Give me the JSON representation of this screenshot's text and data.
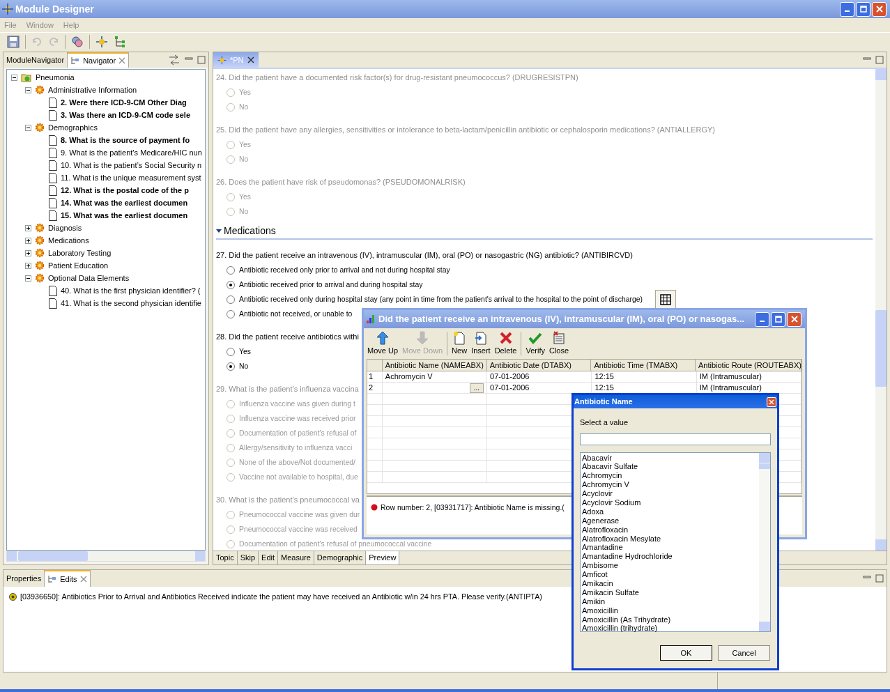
{
  "window": {
    "title": "Module Designer"
  },
  "menu": [
    "File",
    "Window",
    "Help"
  ],
  "left_panel": {
    "tabs": [
      {
        "label": "ModuleNavigator",
        "selected": false
      },
      {
        "label": "Navigator",
        "selected": true
      }
    ],
    "tree": {
      "label": "Pneumonia",
      "kind": "root",
      "expanded": true,
      "children": [
        {
          "label": "Administrative Information",
          "kind": "category",
          "expanded": true,
          "children": [
            {
              "label": "2. Were there ICD-9-CM Other Diag",
              "kind": "question",
              "bold": true
            },
            {
              "label": "3. Was there an ICD-9-CM code sele",
              "kind": "question",
              "bold": true
            }
          ]
        },
        {
          "label": "Demographics",
          "kind": "category",
          "expanded": true,
          "children": [
            {
              "label": "8. What is the source of payment fo",
              "kind": "question",
              "bold": true
            },
            {
              "label": "9. What is the patient’s Medicare/HIC nun",
              "kind": "question",
              "bold": false
            },
            {
              "label": "10. What is the patient’s Social Security n",
              "kind": "question",
              "bold": false
            },
            {
              "label": "11. What is the unique measurement syst",
              "kind": "question",
              "bold": false
            },
            {
              "label": "12. What is the postal code of the p",
              "kind": "question",
              "bold": true
            },
            {
              "label": "14. What was the earliest documen",
              "kind": "question",
              "bold": true
            },
            {
              "label": "15. What was the earliest documen",
              "kind": "question",
              "bold": true
            }
          ]
        },
        {
          "label": "Diagnosis",
          "kind": "category",
          "expanded": false
        },
        {
          "label": "Medications",
          "kind": "category",
          "expanded": false
        },
        {
          "label": "Laboratory Testing",
          "kind": "category",
          "expanded": false
        },
        {
          "label": "Patient Education",
          "kind": "category",
          "expanded": false
        },
        {
          "label": "Optional Data Elements",
          "kind": "category",
          "expanded": true,
          "children": [
            {
              "label": "40. What is the first physician identifier? (",
              "kind": "question",
              "bold": false
            },
            {
              "label": "41. What is the second physician identifie",
              "kind": "question",
              "bold": false
            }
          ]
        }
      ]
    }
  },
  "editor": {
    "tab": "*PN",
    "items": [
      {
        "kind": "question",
        "text": "24. Did the patient have a documented risk factor(s) for drug-resistant pneumococcus? (DRUGRESISTPN)",
        "enabled": false,
        "options": [
          {
            "label": "Yes",
            "selected": false
          },
          {
            "label": "No",
            "selected": false
          }
        ]
      },
      {
        "kind": "question",
        "text": "25. Did the patient have any allergies, sensitivities or intolerance to beta-lactam/penicillin antibiotic or cephalosporin medications? (ANTIALLERGY)",
        "enabled": false,
        "options": [
          {
            "label": "Yes",
            "selected": false
          },
          {
            "label": "No",
            "selected": false
          }
        ]
      },
      {
        "kind": "question",
        "text": "26. Does the patient have risk of pseudomonas? (PSEUDOMONALRISK)",
        "enabled": false,
        "options": [
          {
            "label": "Yes",
            "selected": false
          },
          {
            "label": "No",
            "selected": false
          }
        ]
      },
      {
        "kind": "section",
        "text": "Medications",
        "expanded": true
      },
      {
        "kind": "question",
        "text": "27. Did the patient receive an intravenous (IV), intramuscular (IM), oral (PO) or nasogastric (NG) antibiotic? (ANTIBIRCVD)",
        "enabled": true,
        "table_button": true,
        "options": [
          {
            "label": "Antibiotic received only prior to arrival and not during hospital stay",
            "selected": false
          },
          {
            "label": "Antibiotic received prior to arrival and during hospital stay",
            "selected": true
          },
          {
            "label": "Antibiotic received only during hospital stay (any point in time from the patient's arrival to the hospital to the point of discharge)",
            "selected": false
          },
          {
            "label": "Antibiotic not received, or unable to",
            "selected": false
          }
        ]
      },
      {
        "kind": "question",
        "text": "28. Did the patient receive antibiotics withi",
        "enabled": true,
        "options": [
          {
            "label": "Yes",
            "selected": false
          },
          {
            "label": "No",
            "selected": true
          }
        ]
      },
      {
        "kind": "question",
        "text": "29. What is the patient’s influenza vaccina",
        "enabled": false,
        "options": [
          {
            "label": "Influenza vaccine was given during t",
            "selected": false
          },
          {
            "label": "Influenza vaccine was received prior",
            "selected": false
          },
          {
            "label": "Documentation of patient's refusal of",
            "selected": false
          },
          {
            "label": "Allergy/sensitivity to influenza vacci",
            "selected": false
          },
          {
            "label": "None of the above/Not documented/",
            "selected": false
          },
          {
            "label": "Vaccine not available to hospital, due",
            "selected": false
          }
        ]
      },
      {
        "kind": "question",
        "text": "30. What is the patient’s pneumococcal va",
        "enabled": false,
        "options": [
          {
            "label": "Pneumococcal vaccine was given dur",
            "selected": false
          },
          {
            "label": "Pneumococcal vaccine was received",
            "selected": false
          },
          {
            "label": "Documentation of patient's refusal of pneumococcal vaccine",
            "selected": false
          }
        ]
      }
    ],
    "bottom_tabs": [
      {
        "label": "Topic",
        "selected": false
      },
      {
        "label": "Skip",
        "selected": false
      },
      {
        "label": "Edit",
        "selected": false
      },
      {
        "label": "Measure",
        "selected": false
      },
      {
        "label": "Demographic",
        "selected": false
      },
      {
        "label": "Preview",
        "selected": true
      }
    ]
  },
  "table_dialog": {
    "title": "Did the patient receive an intravenous (IV), intramuscular (IM), oral (PO) or nasogas...",
    "toolbar": [
      {
        "label": "Move Up",
        "kind": "up",
        "disabled": false
      },
      {
        "label": "Move Down",
        "kind": "down",
        "disabled": true
      },
      {
        "label": "New",
        "kind": "new",
        "disabled": false
      },
      {
        "label": "Insert",
        "kind": "insert",
        "disabled": false
      },
      {
        "label": "Delete",
        "kind": "delete",
        "disabled": false
      },
      {
        "label": "Verify",
        "kind": "verify",
        "disabled": false
      },
      {
        "label": "Close",
        "kind": "close",
        "disabled": false
      }
    ],
    "columns": [
      "Antibiotic Name (NAMEABX)",
      "Antibiotic Date (DTABX)",
      "Antibiotic Time (TMABX)",
      "Antibiotic Route (ROUTEABX)"
    ],
    "rows": [
      {
        "number": "1",
        "cells": [
          "Achromycin V",
          "07-01-2006",
          "12:15",
          "IM (Intramuscular)"
        ]
      },
      {
        "number": "2",
        "cells": [
          "",
          "07-01-2006",
          "12:15",
          "IM (Intramuscular)"
        ],
        "picker": "..."
      }
    ],
    "error": "Row number: 2, [03931717]: Antibiotic Name is missing.("
  },
  "picker_dialog": {
    "title": "Antibiotic Name",
    "label": "Select a value",
    "options": [
      "Abacavir",
      "Abacavir Sulfate",
      "Achromycin",
      "Achromycin V",
      "Acyclovir",
      "Acyclovir Sodium",
      "Adoxa",
      "Agenerase",
      "Alatrofloxacin",
      "Alatrofloxacin Mesylate",
      "Amantadine",
      "Amantadine Hydrochloride",
      "Ambisome",
      "Amficot",
      "Amikacin",
      "Amikacin Sulfate",
      "Amikin",
      "Amoxicillin",
      "Amoxicillin (As Trihydrate)",
      "Amoxicillin (trihydrate)"
    ],
    "buttons": [
      "OK",
      "Cancel"
    ]
  },
  "bottom_panel": {
    "tabs": [
      {
        "label": "Properties",
        "selected": false
      },
      {
        "label": "Edits",
        "selected": true
      }
    ],
    "messages": [
      "[03936650]: Antibiotics Prior to Arrival and Antibiotics Received indicate the patient may have received an Antibiotic w/in 24 hrs PTA. Please verify.(ANTIPTA)"
    ]
  }
}
